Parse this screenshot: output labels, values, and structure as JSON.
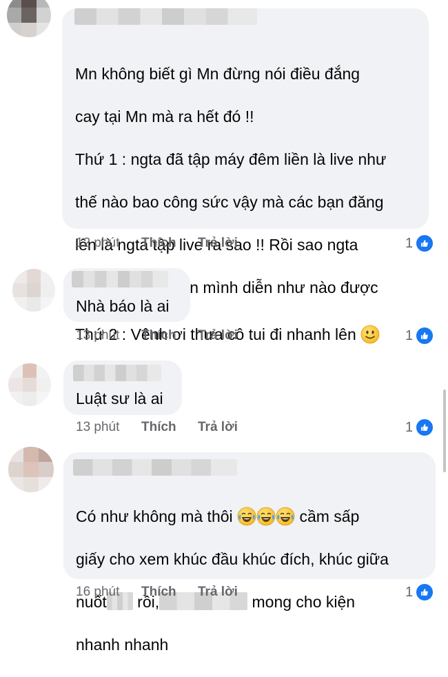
{
  "comments": [
    {
      "lines": [
        "Mn không biết gì Mn đừng nói điều đắng",
        "cay tại Mn mà ra hết đó !!",
        "Thứ 1 : ngta đã tập máy đêm liền là live như",
        "thế nào bao công sức vậy mà các bạn đăng",
        "lên là ngta tập live ra sao !! Rồi sao ngta",
        "giám live thể hiện mình diễn như nào được",
        "Thứ 2 : Vênh ơi thưa cô tui đi nhanh lên"
      ],
      "time": "12 phút",
      "like_label": "Thích",
      "reply_label": "Trả lời",
      "reaction_count": "1"
    },
    {
      "text": "Nhà báo là ai",
      "time": "13 phút",
      "like_label": "Thích",
      "reply_label": "Trả lời",
      "reaction_count": "1"
    },
    {
      "text": "Luật sư là ai",
      "time": "13 phút",
      "like_label": "Thích",
      "reply_label": "Trả lời",
      "reaction_count": "1"
    },
    {
      "line1_a": "Có như không mà thôi",
      "line1_b": "cầm sấp",
      "line2": "giấy cho xem khúc đầu khúc đích, khúc giữa",
      "line3_a": "nuốt",
      "line3_b": "rồi,",
      "line3_c": "mong cho kiện",
      "line4": "nhanh nhanh",
      "time": "16 phút",
      "like_label": "Thích",
      "reply_label": "Trả lời",
      "reaction_count": "1"
    }
  ],
  "colors": {
    "bubble": "#f0f2f5",
    "meta_text": "#65676b",
    "like_blue": "#1877f2"
  },
  "icons": {
    "smile": "slightly-smiling-face-icon",
    "laugh": "face-with-tears-of-joy-icon",
    "like": "thumbs-up-icon"
  }
}
